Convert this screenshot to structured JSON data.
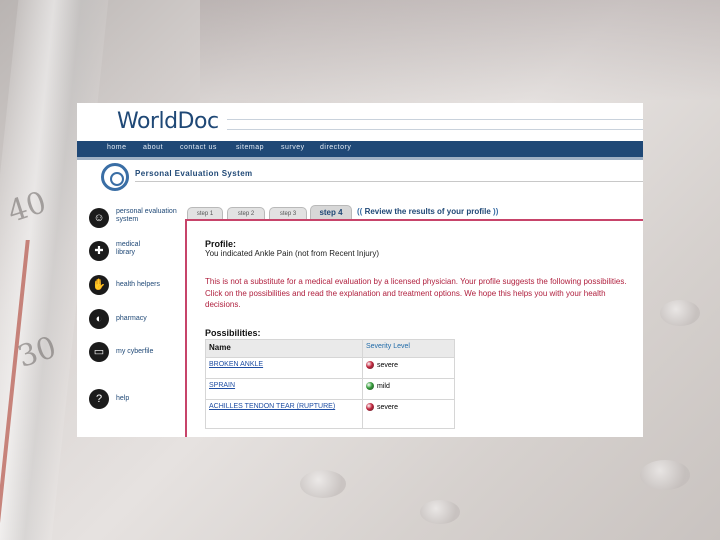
{
  "app": {
    "logo": "WorldDoc"
  },
  "nav": [
    "home",
    "about",
    "contact us",
    "sitemap",
    "survey",
    "directory"
  ],
  "pes_title": "Personal Evaluation System",
  "sidebar": [
    {
      "label": "personal evaluation system",
      "icon": "person-icon"
    },
    {
      "label": "medical library",
      "icon": "book-icon"
    },
    {
      "label": "health helpers",
      "icon": "hand-icon"
    },
    {
      "label": "pharmacy",
      "icon": "pill-icon"
    },
    {
      "label": "my cyberfile",
      "icon": "folder-icon"
    },
    {
      "label": "help",
      "icon": "help-icon"
    }
  ],
  "tabs": [
    "step 1",
    "step 2",
    "step 3",
    "step 4"
  ],
  "active_tab": "step 4",
  "review_text": "Review the results of your profile",
  "profile": {
    "heading": "Profile:",
    "text": "You indicated Ankle Pain (not from Recent Injury)"
  },
  "disclaimer": "This is not a substitute for a medical evaluation by a licensed physician. Your profile suggests the following possibilities. Click on the possibilities and read the explanation and treatment options. We hope this helps you with your health decisions.",
  "possibilities": {
    "heading": "Possibilities:",
    "col_name": "Name",
    "col_severity": "Severity Level",
    "rows": [
      {
        "name": "BROKEN ANKLE",
        "severity": "severe",
        "color": "#c0223a"
      },
      {
        "name": "SPRAIN",
        "severity": "mild",
        "color": "#2f9a35"
      },
      {
        "name": "ACHILLES TENDON TEAR (RUPTURE)",
        "severity": "severe",
        "color": "#c0223a"
      }
    ]
  },
  "background_numbers": [
    "40",
    "30"
  ]
}
